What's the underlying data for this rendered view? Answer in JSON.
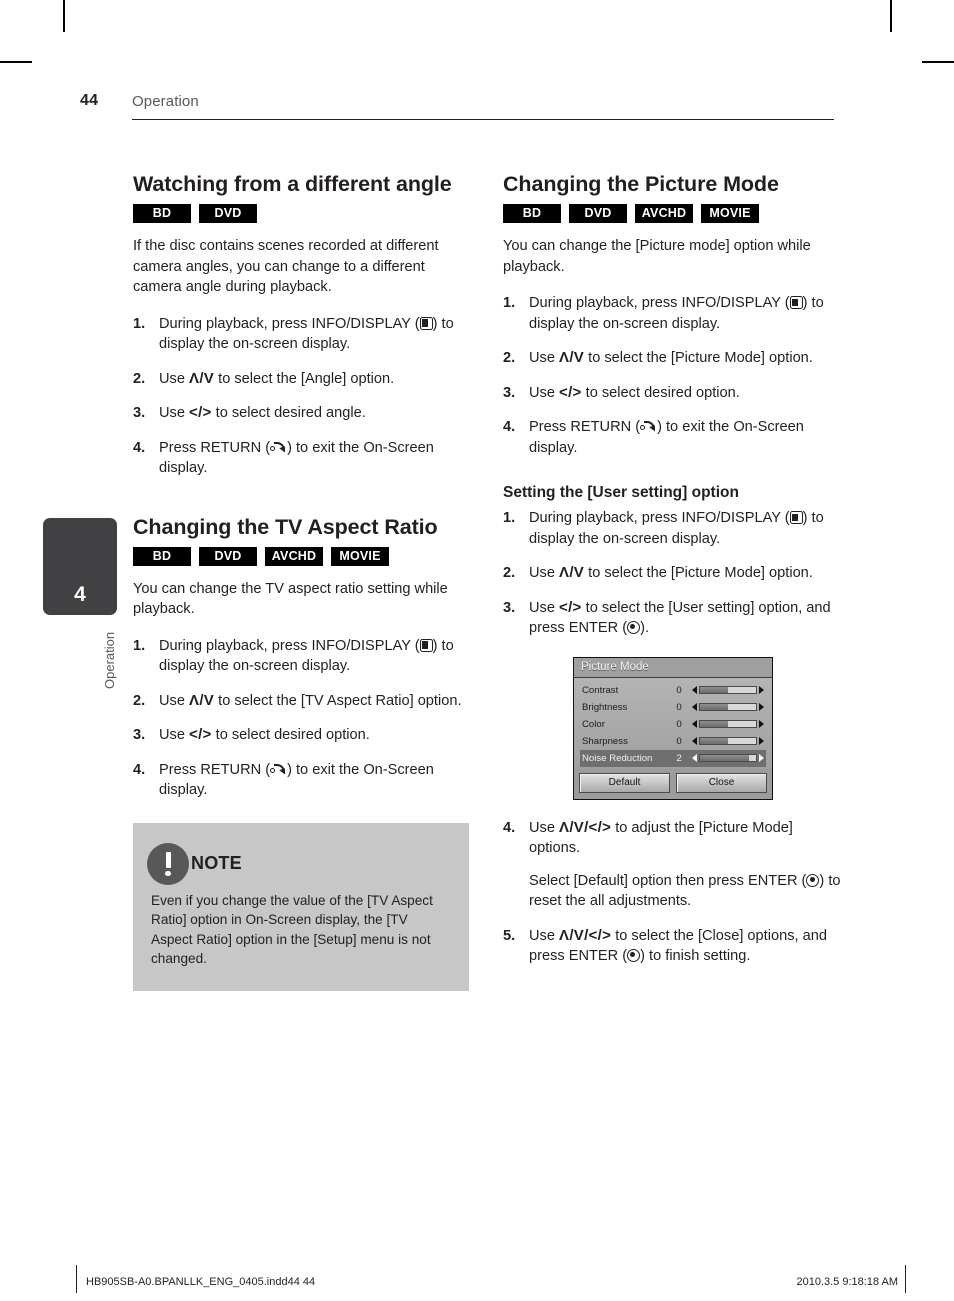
{
  "page": {
    "number": "44",
    "header_title": "Operation",
    "chapter_number": "4",
    "chapter_label": "Operation"
  },
  "left_column": {
    "section1": {
      "title": "Watching from a different angle",
      "badges": [
        "BD",
        "DVD"
      ],
      "intro": "If the disc contains scenes recorded at different camera angles, you can change to a different camera angle during playback.",
      "steps": [
        {
          "num": "1.",
          "pre": "During playback, press INFO/DISPLAY (",
          "icon": "info-display-icon",
          "post": ") to display the on-screen display."
        },
        {
          "num": "2.",
          "pre": "Use ",
          "keys": "Λ/V",
          "post": " to select the [Angle] option."
        },
        {
          "num": "3.",
          "pre": "Use ",
          "keys": "</>",
          "post": " to select desired angle."
        },
        {
          "num": "4.",
          "pre": "Press RETURN (",
          "icon": "return-icon",
          "post": ") to exit the On-Screen display."
        }
      ]
    },
    "section2": {
      "title": "Changing the TV Aspect Ratio",
      "badges": [
        "BD",
        "DVD",
        "AVCHD",
        "MOVIE"
      ],
      "intro": "You can change the TV aspect ratio setting while playback.",
      "steps": [
        {
          "num": "1.",
          "pre": "During playback, press INFO/DISPLAY (",
          "icon": "info-display-icon",
          "post": ") to display the on-screen display."
        },
        {
          "num": "2.",
          "pre": "Use ",
          "keys": "Λ/V",
          "post": " to select the [TV Aspect Ratio] option."
        },
        {
          "num": "3.",
          "pre": "Use ",
          "keys": "</>",
          "post": " to select desired option."
        },
        {
          "num": "4.",
          "pre": "Press RETURN (",
          "icon": "return-icon",
          "post": ") to exit the On-Screen display."
        }
      ]
    },
    "note": {
      "label": "NOTE",
      "text": "Even if you change the value of the [TV Aspect Ratio] option in On-Screen display, the [TV Aspect Ratio] option in the [Setup] menu is not changed."
    }
  },
  "right_column": {
    "section1": {
      "title": "Changing the Picture Mode",
      "badges": [
        "BD",
        "DVD",
        "AVCHD",
        "MOVIE"
      ],
      "intro": "You can change the [Picture mode] option while playback.",
      "steps": [
        {
          "num": "1.",
          "pre": "During playback, press INFO/DISPLAY (",
          "icon": "info-display-icon",
          "post": ") to display the on-screen display."
        },
        {
          "num": "2.",
          "pre": "Use ",
          "keys": "Λ/V",
          "post": " to select the [Picture Mode] option."
        },
        {
          "num": "3.",
          "pre": "Use ",
          "keys": "</>",
          "post": " to select desired option."
        },
        {
          "num": "4.",
          "pre": "Press RETURN (",
          "icon": "return-icon",
          "post": ") to exit the On-Screen display."
        }
      ]
    },
    "subsection": {
      "title": "Setting the [User setting] option",
      "steps": [
        {
          "num": "1.",
          "pre": "During playback, press INFO/DISPLAY (",
          "icon": "info-display-icon",
          "post": ") to display the on-screen display."
        },
        {
          "num": "2.",
          "pre": "Use ",
          "keys": "Λ/V",
          "post": " to select the [Picture Mode] option."
        },
        {
          "num": "3.",
          "pre": "Use ",
          "keys": "</>",
          "post": " to select the [User setting] option, and press ENTER (",
          "icon": "enter-icon",
          "tail": ")."
        },
        {
          "num": "4.",
          "pre": "Use ",
          "keys": "Λ/V/</>",
          "post": " to adjust the [Picture Mode] options.",
          "extra_pre": "Select [Default] option then press ENTER (",
          "extra_icon": "enter-icon",
          "extra_post": ") to reset the all adjustments."
        },
        {
          "num": "5.",
          "pre": "Use ",
          "keys": "Λ/V/</>",
          "post": " to select the [Close] options, and press ENTER (",
          "icon": "enter-icon",
          "tail": ") to finish setting."
        }
      ]
    },
    "osd": {
      "title": "Picture Mode",
      "rows": [
        {
          "label": "Contrast",
          "value": "0",
          "fill_percent": 50,
          "selected": false
        },
        {
          "label": "Brightness",
          "value": "0",
          "fill_percent": 50,
          "selected": false
        },
        {
          "label": "Color",
          "value": "0",
          "fill_percent": 50,
          "selected": false
        },
        {
          "label": "Sharpness",
          "value": "0",
          "fill_percent": 50,
          "selected": false
        },
        {
          "label": "Noise Reduction",
          "value": "2",
          "fill_percent": 88,
          "selected": true
        }
      ],
      "buttons": [
        "Default",
        "Close"
      ]
    }
  },
  "footer": {
    "left": "HB905SB-A0.BPANLLK_ENG_0405.indd44   44",
    "right": "2010.3.5   9:18:18 AM"
  }
}
